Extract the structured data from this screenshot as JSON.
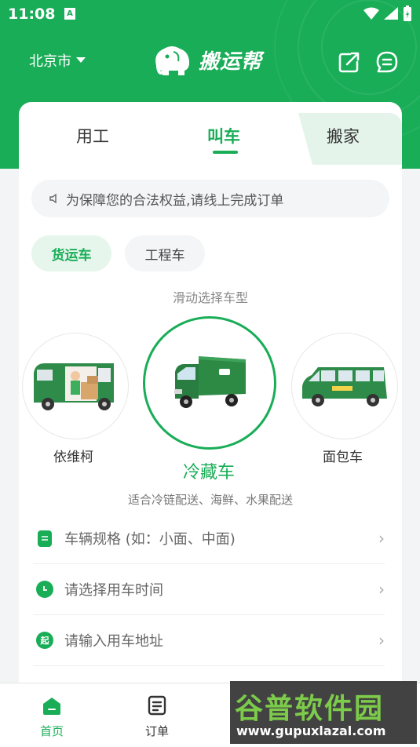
{
  "status": {
    "time": "11:08",
    "a_icon": "A"
  },
  "header": {
    "city": "北京市",
    "logo_text": "搬运帮"
  },
  "tabs": [
    {
      "label": "用工"
    },
    {
      "label": "叫车"
    },
    {
      "label": "搬家"
    }
  ],
  "notice": {
    "text": "为保障您的合法权益,请线上完成订单"
  },
  "chips": [
    {
      "label": "货运车"
    },
    {
      "label": "工程车"
    }
  ],
  "slide_hint": "滑动选择车型",
  "vehicles": [
    {
      "label": "依维柯"
    },
    {
      "label": "冷藏车"
    },
    {
      "label": "面包车"
    }
  ],
  "vehicle_desc": "适合冷链配送、海鲜、水果配送",
  "form": {
    "spec": "车辆规格 (如：小面、中面)",
    "time": "请选择用车时间",
    "address": "请输入用车地址",
    "address_icon": "起"
  },
  "nav": [
    {
      "label": "首页"
    },
    {
      "label": "订单"
    }
  ],
  "watermark": {
    "title": "谷普软件园",
    "url": "www.gupuxlazal.com"
  },
  "colors": {
    "brand": "#19ad57"
  }
}
